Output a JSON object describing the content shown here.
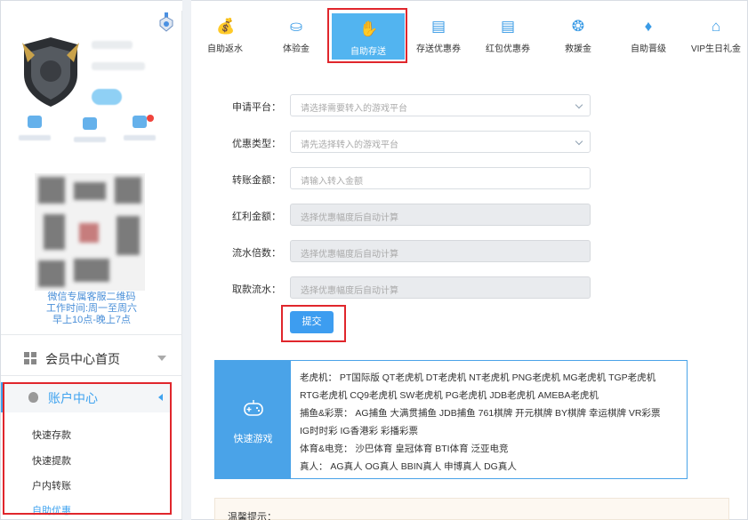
{
  "toolbar": {
    "items": [
      {
        "label": "自助返水",
        "icon": "money-bag-icon"
      },
      {
        "label": "体验金",
        "icon": "gold-ingot-icon"
      },
      {
        "label": "自助存送",
        "icon": "hand-coin-icon"
      },
      {
        "label": "存送优惠券",
        "icon": "coupon-icon"
      },
      {
        "label": "红包优惠券",
        "icon": "red-packet-coupon-icon"
      },
      {
        "label": "救援金",
        "icon": "lifebuoy-icon"
      },
      {
        "label": "自助晋级",
        "icon": "diamond-icon"
      },
      {
        "label": "VIP生日礼金",
        "icon": "cake-icon"
      }
    ],
    "active_index": 2
  },
  "sidebar": {
    "wechat_qr_caption": "微信专属客服二维码",
    "work_time": "工作时间:周一至周六",
    "work_hours": "早上10点-晚上7点",
    "menu_home": "会员中心首页",
    "account_center": "账户中心",
    "sub_items": [
      "快速存款",
      "快速提款",
      "户内转账",
      "自助优惠"
    ],
    "active_sub_index": 3
  },
  "form": {
    "fields": [
      {
        "label": "申请平台：",
        "placeholder": "请选择需要转入的游戏平台",
        "type": "select"
      },
      {
        "label": "优惠类型：",
        "placeholder": "请先选择转入的游戏平台",
        "type": "select"
      },
      {
        "label": "转账金额：",
        "placeholder": "请输入转入金额",
        "type": "input"
      },
      {
        "label": "红利金额：",
        "placeholder": "选择优惠幅度后自动计算",
        "type": "disabled"
      },
      {
        "label": "流水倍数：",
        "placeholder": "选择优惠幅度后自动计算",
        "type": "disabled"
      },
      {
        "label": "取款流水：",
        "placeholder": "选择优惠幅度后自动计算",
        "type": "disabled"
      }
    ],
    "submit_label": "提交"
  },
  "games": {
    "title": "快速游戏",
    "lines": [
      "老虎机：  PT国际版   QT老虎机   DT老虎机   NT老虎机   PNG老虎机   MG老虎机   TGP老虎机",
      "RTG老虎机   CQ9老虎机   SW老虎机   PG老虎机   JDB老虎机   AMEBA老虎机",
      "捕鱼&彩票：  AG捕鱼   大满贯捕鱼   JDB捕鱼   761棋牌   开元棋牌   BY棋牌   幸运棋牌   VR彩票",
      "IG时时彩   IG香港彩   彩播彩票",
      "体育&电竞：  沙巴体育   皇冠体育   BTI体育   泛亚电竞",
      "真人：   AG真人   OG真人   BBIN真人   申博真人   DG真人"
    ]
  },
  "tip": {
    "label": "温馨提示："
  },
  "colors": {
    "accent": "#3d9df0",
    "active_tab": "#52b4f0",
    "highlight_border": "#e0262c"
  }
}
